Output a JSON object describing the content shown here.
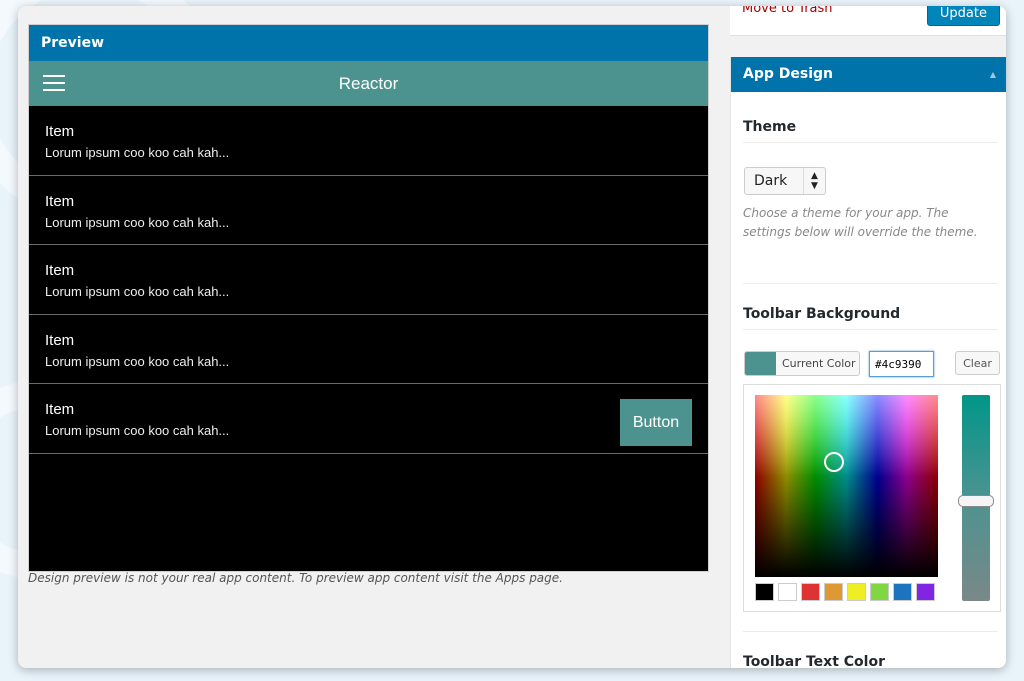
{
  "preview": {
    "header": "Preview",
    "app_title": "Reactor",
    "items": [
      {
        "title": "Item",
        "subtitle": "Lorum ipsum coo koo cah kah..."
      },
      {
        "title": "Item",
        "subtitle": "Lorum ipsum coo koo cah kah..."
      },
      {
        "title": "Item",
        "subtitle": "Lorum ipsum coo koo cah kah..."
      },
      {
        "title": "Item",
        "subtitle": "Lorum ipsum coo koo cah kah..."
      },
      {
        "title": "Item",
        "subtitle": "Lorum ipsum coo koo cah kah...",
        "button": "Button"
      }
    ],
    "note": "Design preview is not your real app content. To preview app content visit the Apps page."
  },
  "publish": {
    "move_to_trash": "Move to Trash",
    "update": "Update"
  },
  "app_design": {
    "header": "App Design",
    "theme": {
      "title": "Theme",
      "selected": "Dark",
      "description": "Choose a theme for your app. The settings below will override the theme."
    },
    "toolbar_background": {
      "title": "Toolbar Background",
      "current_color_label": "Current Color",
      "hex_value": "#4c9390",
      "clear_label": "Clear",
      "swatches": [
        "#000000",
        "#ffffff",
        "#dd3333",
        "#dd9933",
        "#eeee22",
        "#81d742",
        "#1e73be",
        "#8224e3"
      ]
    },
    "toolbar_text_color": {
      "title": "Toolbar Text Color"
    }
  },
  "colors": {
    "accent": "#0073aa",
    "toolbar": "#4c9390"
  }
}
